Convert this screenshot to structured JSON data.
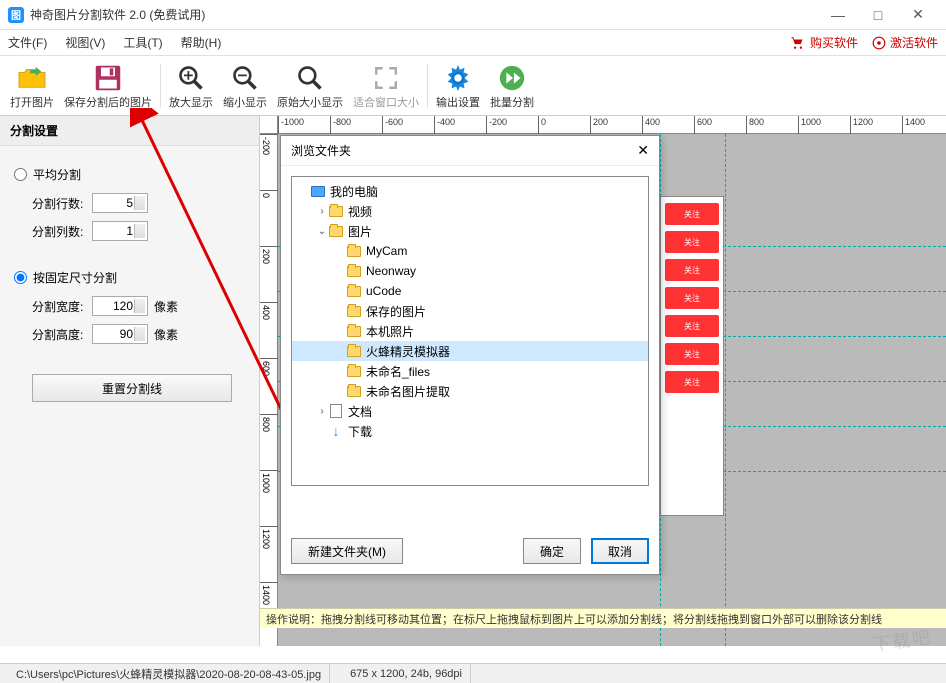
{
  "window": {
    "title": "神奇图片分割软件 2.0 (免费试用)",
    "minimize": "—",
    "maximize": "□",
    "close": "✕"
  },
  "menu": {
    "file": "文件(F)",
    "view": "视图(V)",
    "tools": "工具(T)",
    "help": "帮助(H)",
    "buy": "购买软件",
    "activate": "激活软件"
  },
  "toolbar": {
    "open": "打开图片",
    "save": "保存分割后的图片",
    "zoom_in": "放大显示",
    "zoom_out": "缩小显示",
    "zoom_orig": "原始大小显示",
    "fit_window": "适合窗口大小",
    "output": "输出设置",
    "batch": "批量分割"
  },
  "panel": {
    "title": "分割设置",
    "mode_avg": "平均分割",
    "rows_label": "分割行数:",
    "rows_value": "5",
    "cols_label": "分割列数:",
    "cols_value": "1",
    "mode_fixed": "按固定尺寸分割",
    "width_label": "分割宽度:",
    "width_value": "120",
    "height_label": "分割高度:",
    "height_value": "90",
    "pixel": "像素",
    "reset": "重置分割线"
  },
  "ruler_h": [
    "-1000",
    "-800",
    "-600",
    "-400",
    "-200",
    "0",
    "200",
    "400",
    "600",
    "800",
    "1000",
    "1200",
    "1400"
  ],
  "ruler_v": [
    "-200",
    "0",
    "200",
    "400",
    "600",
    "800",
    "1000",
    "1200",
    "1400"
  ],
  "badge": "关注",
  "dialog": {
    "title": "浏览文件夹",
    "close": "✕",
    "tree": [
      {
        "indent": 0,
        "exp": "",
        "icon": "pc",
        "label": "我的电脑"
      },
      {
        "indent": 1,
        "exp": "›",
        "icon": "folder",
        "label": "视频"
      },
      {
        "indent": 1,
        "exp": "⌄",
        "icon": "folder",
        "label": "图片"
      },
      {
        "indent": 2,
        "exp": "",
        "icon": "folder",
        "label": "MyCam"
      },
      {
        "indent": 2,
        "exp": "",
        "icon": "folder",
        "label": "Neonway"
      },
      {
        "indent": 2,
        "exp": "",
        "icon": "folder",
        "label": "uCode"
      },
      {
        "indent": 2,
        "exp": "",
        "icon": "folder",
        "label": "保存的图片"
      },
      {
        "indent": 2,
        "exp": "",
        "icon": "folder",
        "label": "本机照片"
      },
      {
        "indent": 2,
        "exp": "",
        "icon": "folder",
        "label": "火蜂精灵模拟器",
        "selected": true
      },
      {
        "indent": 2,
        "exp": "",
        "icon": "folder",
        "label": "未命名_files"
      },
      {
        "indent": 2,
        "exp": "",
        "icon": "folder",
        "label": "未命名图片提取"
      },
      {
        "indent": 1,
        "exp": "›",
        "icon": "doc",
        "label": "文档"
      },
      {
        "indent": 1,
        "exp": "",
        "icon": "dl",
        "label": "下载"
      }
    ],
    "new_folder": "新建文件夹(M)",
    "ok": "确定",
    "cancel": "取消"
  },
  "help_text": "操作说明：拖拽分割线可移动其位置；在标尺上拖拽鼠标到图片上可以添加分割线；将分割线拖拽到窗口外部可以删除该分割线",
  "status": {
    "path": "C:\\Users\\pc\\Pictures\\火蜂精灵模拟器\\2020-08-20-08-43-05.jpg",
    "info": "675 x 1200, 24b, 96dpi"
  },
  "watermark": "下载吧"
}
